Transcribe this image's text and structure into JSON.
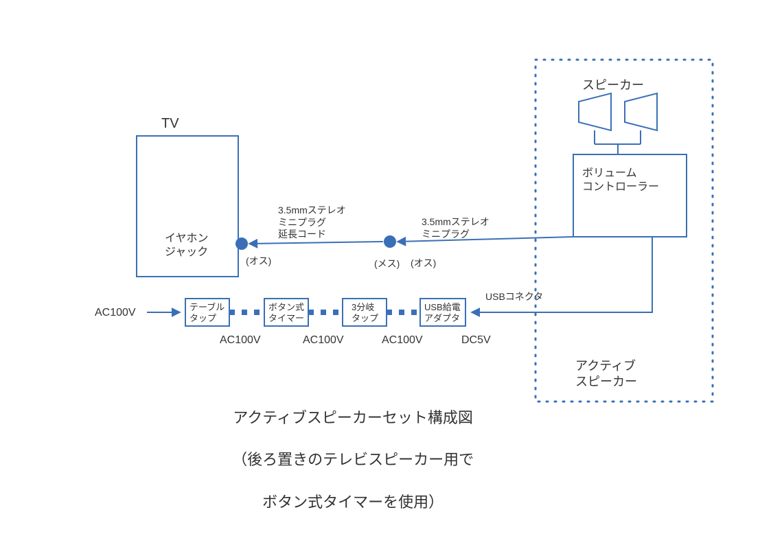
{
  "tv": {
    "label": "TV",
    "jack": "イヤホン\nジャック"
  },
  "speaker": {
    "group_label": "アクティブ\nスピーカー",
    "speakers_label": "スピーカー",
    "volume_label": "ボリューム\nコントローラー"
  },
  "audio": {
    "ext_cord": "3.5mmステレオ\nミニプラグ\n延長コード",
    "mini_plug": "3.5mmステレオ\nミニプラグ",
    "male_left": "(オス)",
    "female": "(メス)",
    "male_right": "(オス)"
  },
  "power": {
    "source": "AC100V",
    "tap": "テーブル\nタップ",
    "timer": "ボタン式\nタイマー",
    "splitter": "3分岐\nタップ",
    "usb_adapter": "USB給電\nアダプタ",
    "usb_connector": "USBコネクタ",
    "v1": "AC100V",
    "v2": "AC100V",
    "v3": "AC100V",
    "v4": "DC5V"
  },
  "title": {
    "line1": "アクティブスピーカーセット構成図",
    "line2": "（後ろ置きのテレビスピーカー用で",
    "line3": "ボタン式タイマーを使用）"
  },
  "colors": {
    "stroke": "#3a6fb7",
    "fill_dot": "#3a6fb7"
  }
}
